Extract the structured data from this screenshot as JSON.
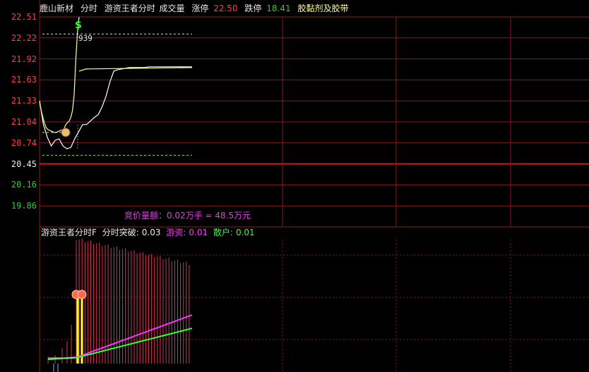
{
  "header": {
    "stock_name": "鹿山新材",
    "view_mode": "分时",
    "indicator_name": "游资王者分时",
    "volume_label": "成交量",
    "limit_up_label": "涨停",
    "limit_up_value": "22.50",
    "limit_down_label": "跌停",
    "limit_down_value": "18.41",
    "sector": "胶黏剂及胶带"
  },
  "colors": {
    "background": "#000000",
    "grid": "#8b1a1a",
    "up": "#ff4040",
    "down": "#33cc33",
    "price_line": "#ffffff",
    "avg_line": "#ffff99",
    "magenta": "#ff33ff",
    "green": "#33ff33",
    "yellow": "#ffff33"
  },
  "price_axis": {
    "ticks": [
      "22.51",
      "22.22",
      "21.92",
      "21.63",
      "21.33",
      "21.04",
      "20.74",
      "20.45",
      "20.16",
      "19.86"
    ],
    "prev_close": "20.45",
    "range": [
      19.86,
      22.51
    ]
  },
  "price_chart": {
    "price_series": [
      21.33,
      21.2,
      21.1,
      21.02,
      20.96,
      20.93,
      20.92,
      20.91,
      20.9,
      20.89,
      20.89,
      20.9,
      20.91,
      20.92,
      20.93,
      20.95,
      21.0,
      21.03,
      21.05,
      21.1,
      21.2,
      21.42,
      21.9,
      22.3,
      22.51
    ],
    "avg_series": [
      21.33,
      21.0,
      20.82,
      20.7,
      20.78,
      20.8,
      20.7,
      20.66,
      20.68,
      20.8,
      20.9,
      21.0,
      21.0,
      21.05,
      21.1,
      21.14,
      21.25,
      21.4,
      21.6,
      21.75,
      21.77,
      21.78,
      21.79,
      21.8,
      21.8,
      21.8,
      21.8,
      21.8,
      21.81,
      21.81,
      21.81,
      21.81,
      21.81,
      21.81,
      21.81,
      21.81,
      21.81,
      21.81,
      21.81,
      21.81
    ],
    "high_marker_value": "939",
    "high_ref_price": 22.27,
    "low_ref_price": 20.57,
    "low_mark_price": 20.89,
    "high_marker_icon": "dollar-icon",
    "low_marker_icon": "money-bag-icon"
  },
  "auction_text": "竞价量额：0.02万手 = 48.5万元",
  "sub_chart": {
    "title": "游资王者分时F",
    "breakout_label": "分时突破:",
    "breakout_value": "0.03",
    "hot_money_label": "游资:",
    "hot_money_value": "0.01",
    "retail_label": "散户:",
    "retail_value": "0.01",
    "icon": "peach-icon"
  }
}
